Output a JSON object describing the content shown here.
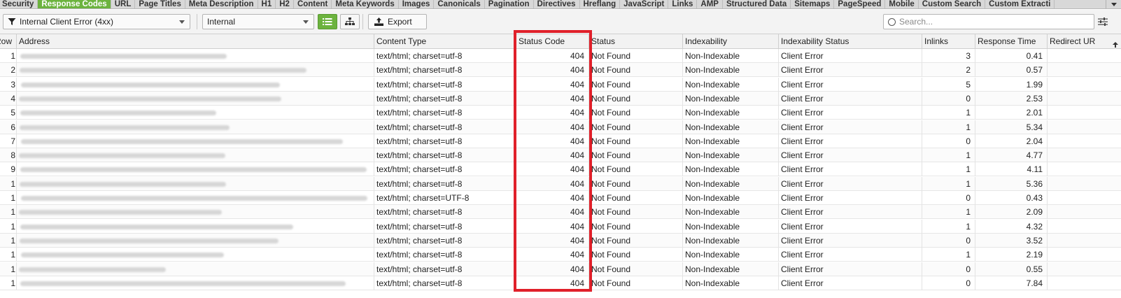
{
  "tabs": [
    {
      "label": "Security",
      "active": false
    },
    {
      "label": "Response Codes",
      "active": true
    },
    {
      "label": "URL",
      "active": false
    },
    {
      "label": "Page Titles",
      "active": false
    },
    {
      "label": "Meta Description",
      "active": false
    },
    {
      "label": "H1",
      "active": false
    },
    {
      "label": "H2",
      "active": false
    },
    {
      "label": "Content",
      "active": false
    },
    {
      "label": "Meta Keywords",
      "active": false
    },
    {
      "label": "Images",
      "active": false
    },
    {
      "label": "Canonicals",
      "active": false
    },
    {
      "label": "Pagination",
      "active": false
    },
    {
      "label": "Directives",
      "active": false
    },
    {
      "label": "Hreflang",
      "active": false
    },
    {
      "label": "JavaScript",
      "active": false
    },
    {
      "label": "Links",
      "active": false
    },
    {
      "label": "AMP",
      "active": false
    },
    {
      "label": "Structured Data",
      "active": false
    },
    {
      "label": "Sitemaps",
      "active": false
    },
    {
      "label": "PageSpeed",
      "active": false
    },
    {
      "label": "Mobile",
      "active": false
    },
    {
      "label": "Custom Search",
      "active": false
    },
    {
      "label": "Custom Extracti",
      "active": false
    }
  ],
  "toolbar": {
    "filter_value": "Internal Client Error (4xx)",
    "scope_value": "Internal",
    "export_label": "Export",
    "search_placeholder": "Search..."
  },
  "colors": {
    "accent": "#6cb33e",
    "highlight": "#e0202a"
  },
  "table": {
    "columns": [
      "Row",
      "Address",
      "Content Type",
      "Status Code",
      "Status",
      "Indexability",
      "Indexability Status",
      "Inlinks",
      "Response Time",
      "Redirect UR"
    ],
    "rows": [
      {
        "row": "1",
        "content_type": "text/html; charset=utf-8",
        "status_code": "404",
        "status": "Not Found",
        "indexability": "Non-Indexable",
        "indexability_status": "Client Error",
        "inlinks": "3",
        "response_time": "0.41"
      },
      {
        "row": "2",
        "content_type": "text/html; charset=utf-8",
        "status_code": "404",
        "status": "Not Found",
        "indexability": "Non-Indexable",
        "indexability_status": "Client Error",
        "inlinks": "2",
        "response_time": "0.57"
      },
      {
        "row": "3",
        "content_type": "text/html; charset=utf-8",
        "status_code": "404",
        "status": "Not Found",
        "indexability": "Non-Indexable",
        "indexability_status": "Client Error",
        "inlinks": "5",
        "response_time": "1.99"
      },
      {
        "row": "4",
        "content_type": "text/html; charset=utf-8",
        "status_code": "404",
        "status": "Not Found",
        "indexability": "Non-Indexable",
        "indexability_status": "Client Error",
        "inlinks": "0",
        "response_time": "2.53"
      },
      {
        "row": "5",
        "content_type": "text/html; charset=utf-8",
        "status_code": "404",
        "status": "Not Found",
        "indexability": "Non-Indexable",
        "indexability_status": "Client Error",
        "inlinks": "1",
        "response_time": "2.01"
      },
      {
        "row": "6",
        "content_type": "text/html; charset=utf-8",
        "status_code": "404",
        "status": "Not Found",
        "indexability": "Non-Indexable",
        "indexability_status": "Client Error",
        "inlinks": "1",
        "response_time": "5.34"
      },
      {
        "row": "7",
        "content_type": "text/html; charset=utf-8",
        "status_code": "404",
        "status": "Not Found",
        "indexability": "Non-Indexable",
        "indexability_status": "Client Error",
        "inlinks": "0",
        "response_time": "2.04"
      },
      {
        "row": "8",
        "content_type": "text/html; charset=utf-8",
        "status_code": "404",
        "status": "Not Found",
        "indexability": "Non-Indexable",
        "indexability_status": "Client Error",
        "inlinks": "1",
        "response_time": "4.77"
      },
      {
        "row": "9",
        "content_type": "text/html; charset=utf-8",
        "status_code": "404",
        "status": "Not Found",
        "indexability": "Non-Indexable",
        "indexability_status": "Client Error",
        "inlinks": "1",
        "response_time": "4.11"
      },
      {
        "row": "1",
        "content_type": "text/html; charset=utf-8",
        "status_code": "404",
        "status": "Not Found",
        "indexability": "Non-Indexable",
        "indexability_status": "Client Error",
        "inlinks": "1",
        "response_time": "5.36"
      },
      {
        "row": "1",
        "content_type": "text/html; charset=UTF-8",
        "status_code": "404",
        "status": "Not Found",
        "indexability": "Non-Indexable",
        "indexability_status": "Client Error",
        "inlinks": "0",
        "response_time": "0.43"
      },
      {
        "row": "1",
        "content_type": "text/html; charset=utf-8",
        "status_code": "404",
        "status": "Not Found",
        "indexability": "Non-Indexable",
        "indexability_status": "Client Error",
        "inlinks": "1",
        "response_time": "2.09"
      },
      {
        "row": "1",
        "content_type": "text/html; charset=utf-8",
        "status_code": "404",
        "status": "Not Found",
        "indexability": "Non-Indexable",
        "indexability_status": "Client Error",
        "inlinks": "1",
        "response_time": "4.32"
      },
      {
        "row": "1",
        "content_type": "text/html; charset=utf-8",
        "status_code": "404",
        "status": "Not Found",
        "indexability": "Non-Indexable",
        "indexability_status": "Client Error",
        "inlinks": "0",
        "response_time": "3.52"
      },
      {
        "row": "1",
        "content_type": "text/html; charset=utf-8",
        "status_code": "404",
        "status": "Not Found",
        "indexability": "Non-Indexable",
        "indexability_status": "Client Error",
        "inlinks": "1",
        "response_time": "2.19"
      },
      {
        "row": "1",
        "content_type": "text/html; charset=utf-8",
        "status_code": "404",
        "status": "Not Found",
        "indexability": "Non-Indexable",
        "indexability_status": "Client Error",
        "inlinks": "0",
        "response_time": "0.55"
      },
      {
        "row": "1",
        "content_type": "text/html; charset=utf-8",
        "status_code": "404",
        "status": "Not Found",
        "indexability": "Non-Indexable",
        "indexability_status": "Client Error",
        "inlinks": "0",
        "response_time": "7.84"
      }
    ]
  }
}
